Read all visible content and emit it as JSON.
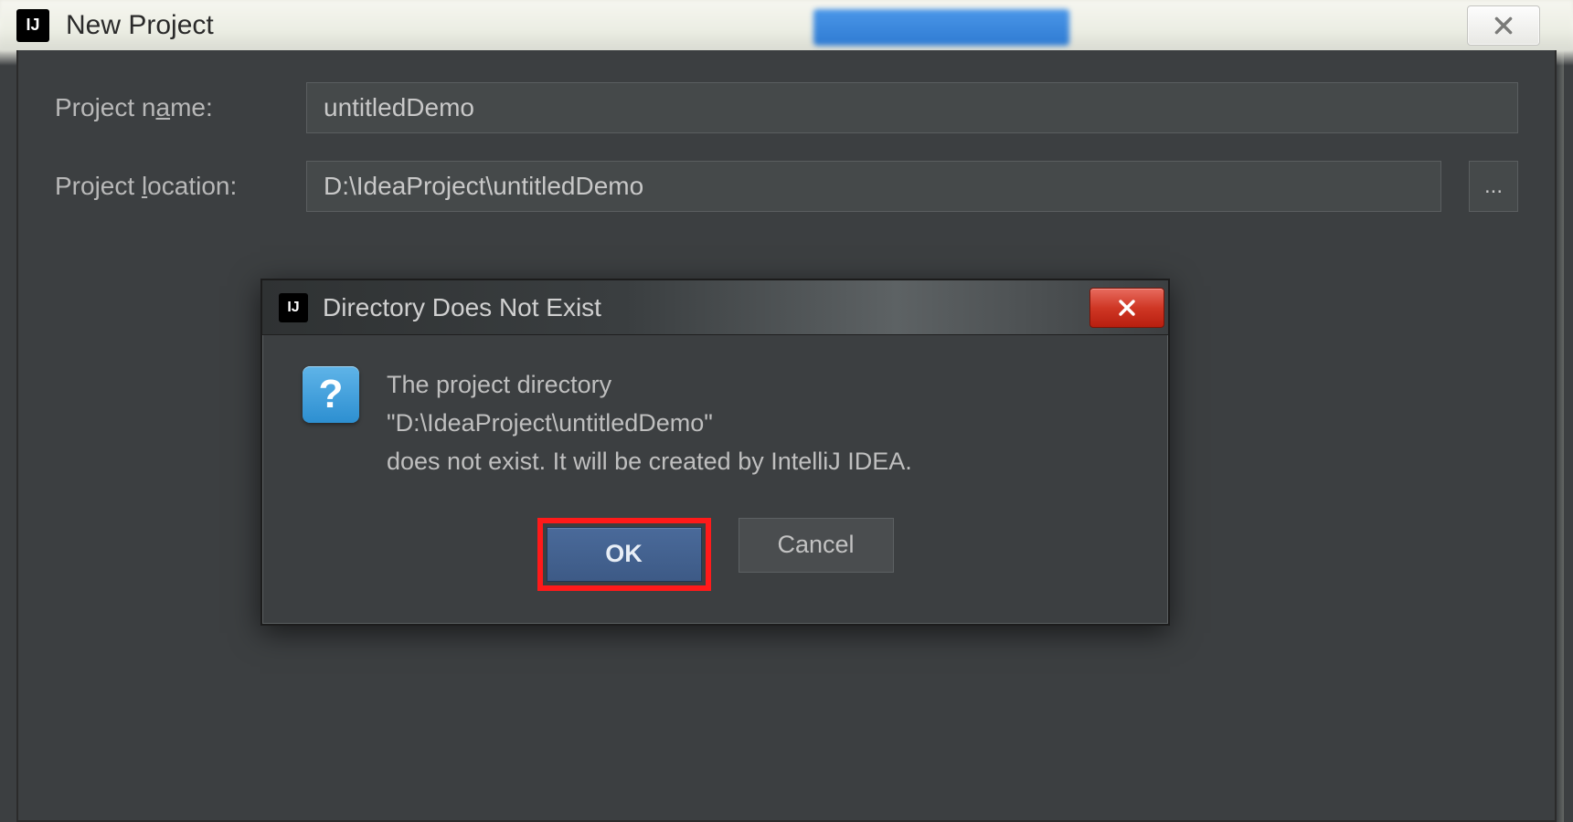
{
  "outer_window": {
    "title": "New Project"
  },
  "form": {
    "name_label_pre": "Project n",
    "name_label_u": "a",
    "name_label_post": "me:",
    "name_value": "untitledDemo",
    "loc_label_pre": "Project ",
    "loc_label_u": "l",
    "loc_label_post": "ocation:",
    "loc_value": "D:\\IdeaProject\\untitledDemo",
    "browse_label": "..."
  },
  "modal": {
    "title": "Directory Does Not Exist",
    "icon_char": "?",
    "message_line1": "The project directory",
    "message_line2": "\"D:\\IdeaProject\\untitledDemo\"",
    "message_line3": "does not exist. It will be created by IntelliJ IDEA.",
    "ok_label": "OK",
    "cancel_label": "Cancel"
  }
}
